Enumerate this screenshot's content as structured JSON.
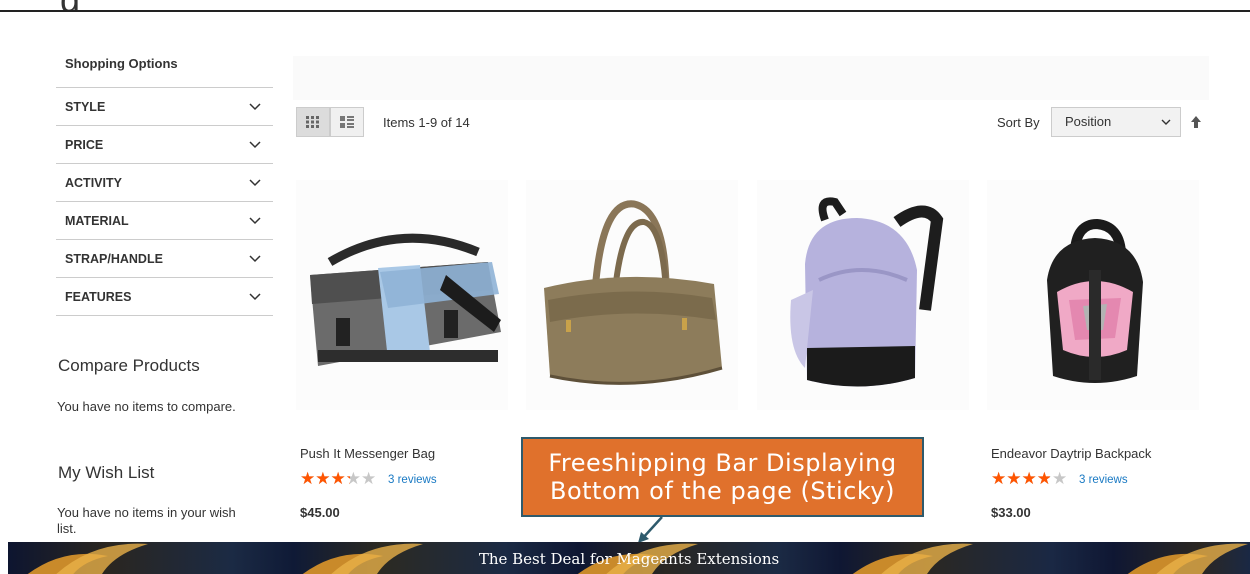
{
  "page": {
    "title_fragment": "g"
  },
  "sidebar": {
    "title": "Shopping Options",
    "filters": [
      "STYLE",
      "PRICE",
      "ACTIVITY",
      "MATERIAL",
      "STRAP/HANDLE",
      "FEATURES"
    ],
    "compare": {
      "title": "Compare Products",
      "empty": "You have no items to compare."
    },
    "wishlist": {
      "title": "My Wish List",
      "empty": "You have no items in your wish list."
    }
  },
  "toolbar": {
    "items_amount": "Items 1-9 of 14",
    "sort_label": "Sort By",
    "sort_value": "Position"
  },
  "products": [
    {
      "name": "Push It Messenger Bag",
      "rating": 0.6,
      "reviews": "3 reviews",
      "price": "$45.00"
    },
    {
      "name": "",
      "rating": 0,
      "reviews": "",
      "price": ""
    },
    {
      "name": "",
      "rating": 0,
      "reviews": "",
      "price": ""
    },
    {
      "name": "Endeavor Daytrip Backpack",
      "rating": 0.7,
      "reviews": "3 reviews",
      "price": "$33.00"
    }
  ],
  "callout": {
    "line1": "Freeshipping Bar Displaying",
    "line2": "Bottom of the page (Sticky)"
  },
  "free_bar": {
    "text": "The Best Deal for Mageants Extensions"
  },
  "colors": {
    "accent": "#e0712c",
    "star": "#ff5501",
    "link": "#1979c3",
    "bar": "#1b2a44"
  }
}
